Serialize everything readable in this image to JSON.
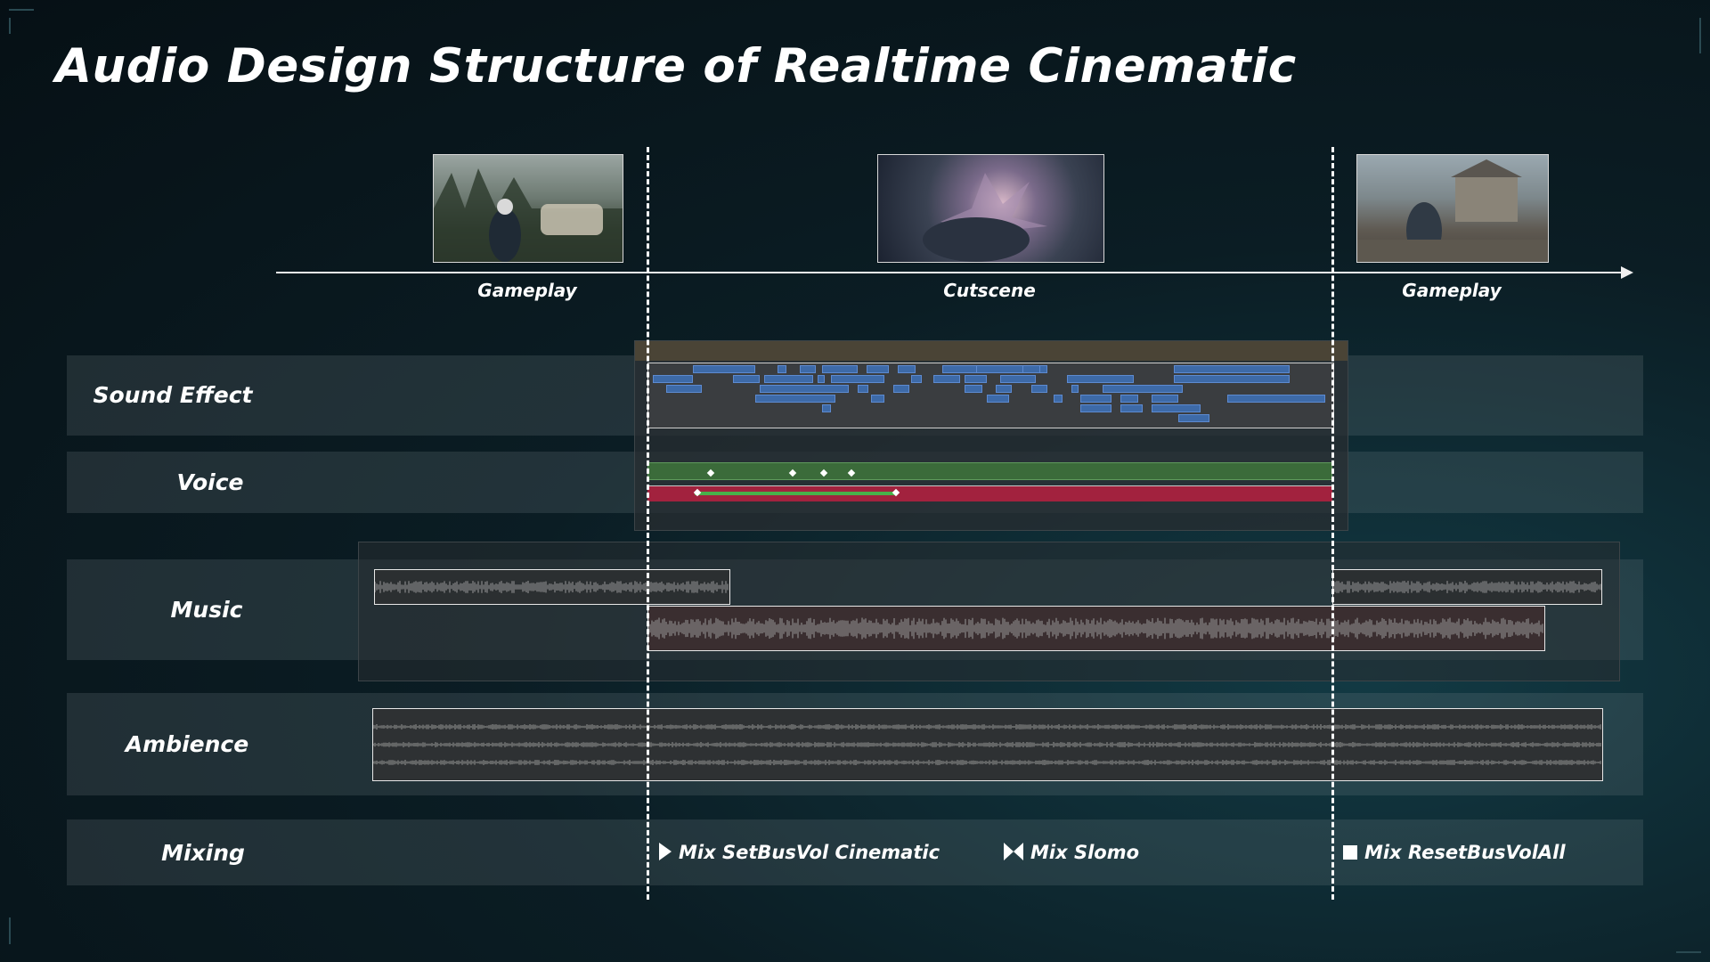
{
  "title": "Audio Design Structure of Realtime Cinematic",
  "phases": [
    "Gameplay",
    "Cutscene",
    "Gameplay"
  ],
  "rows": [
    "Sound Effect",
    "Voice",
    "Music",
    "Ambience",
    "Mixing"
  ],
  "mixing": [
    {
      "icon": "play-icon",
      "label": "Mix SetBusVol Cinematic"
    },
    {
      "icon": "bowtie-icon",
      "label": "Mix Slomo"
    },
    {
      "icon": "stop-icon",
      "label": "Mix ResetBusVolAll"
    }
  ],
  "colors": {
    "accent": "#ffffff",
    "sfx_clip": "#3d6aa8",
    "voice_green": "#3b6b3a",
    "voice_red": "#a2223e"
  }
}
